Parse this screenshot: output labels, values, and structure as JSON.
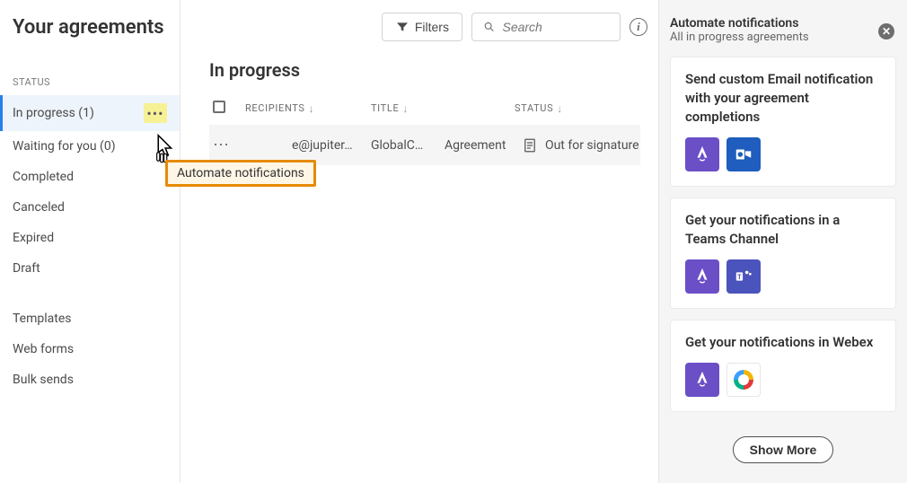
{
  "page_title": "Your agreements",
  "topbar": {
    "filters_label": "Filters",
    "search_placeholder": "Search"
  },
  "sidebar": {
    "heading": "STATUS",
    "items": [
      {
        "label": "In progress (1)",
        "active": true,
        "has_more": true
      },
      {
        "label": "Waiting for you (0)"
      },
      {
        "label": "Completed"
      },
      {
        "label": "Canceled"
      },
      {
        "label": "Expired"
      },
      {
        "label": "Draft"
      }
    ],
    "group2": [
      {
        "label": "Templates"
      },
      {
        "label": "Web forms"
      },
      {
        "label": "Bulk sends"
      }
    ]
  },
  "popover": {
    "menu_label": "Automate notifications"
  },
  "main": {
    "section_title": "In progress",
    "columns": {
      "recipients": "RECIPIENTS",
      "title": "TITLE",
      "status": "STATUS"
    },
    "rows": [
      {
        "recipients": "e@jupiter.dom",
        "title": "GlobalC…",
        "type": "Agreement",
        "status": "Out for signature"
      }
    ]
  },
  "panel": {
    "title": "Automate notifications",
    "subtitle": "All in progress agreements",
    "cards": [
      {
        "title": "Send custom Email notification with your agreement completions",
        "badges": [
          "acrobat",
          "outlook"
        ]
      },
      {
        "title": "Get your notifications in a Teams Channel",
        "badges": [
          "acrobat",
          "teams"
        ]
      },
      {
        "title": "Get your notifications in Webex",
        "badges": [
          "acrobat",
          "webex"
        ]
      }
    ],
    "show_more": "Show More"
  }
}
